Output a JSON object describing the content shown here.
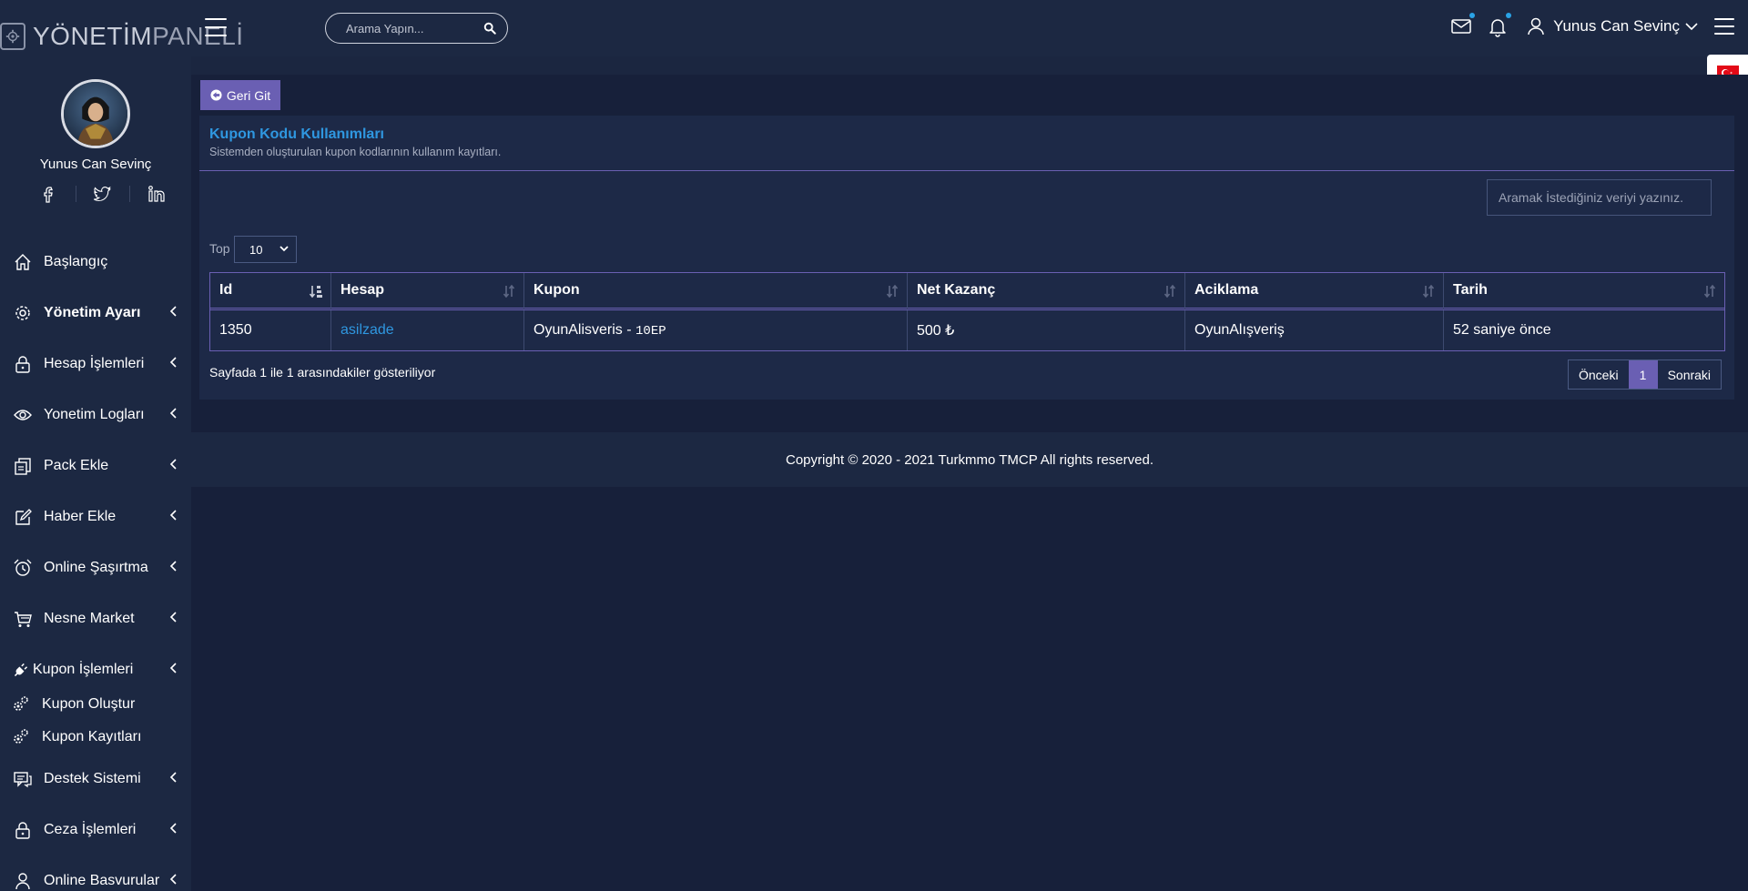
{
  "topbar": {
    "logo_bold": "YÖNETİM",
    "logo_thin": "PANELİ",
    "search_placeholder": "Arama Yapın...",
    "user_name": "Yunus Can Sevinç"
  },
  "sidebar": {
    "user_name": "Yunus Can Sevinç",
    "socials": [
      "facebook-icon",
      "twitter-icon",
      "linkedin-icon"
    ],
    "items": [
      {
        "label": "Başlangıç",
        "icon": "home-icon"
      },
      {
        "label": "Yönetim Ayarı",
        "icon": "gear-icon"
      },
      {
        "label": "Hesap İşlemleri",
        "icon": "lock-icon"
      },
      {
        "label": "Yonetim Logları",
        "icon": "eye-icon"
      },
      {
        "label": "Pack Ekle",
        "icon": "copy-icon"
      },
      {
        "label": "Haber Ekle",
        "icon": "edit-icon"
      },
      {
        "label": "Online Şaşırtma",
        "icon": "alarm-clock-icon"
      },
      {
        "label": "Nesne Market",
        "icon": "cart-icon"
      },
      {
        "label": "Kupon İşlemleri",
        "icon": "plug-icon"
      },
      {
        "label": "Kupon Oluştur",
        "icon": "gears-icon"
      },
      {
        "label": "Kupon Kayıtları",
        "icon": "gears-icon"
      },
      {
        "label": "Destek Sistemi",
        "icon": "chat-icon"
      },
      {
        "label": "Ceza İşlemleri",
        "icon": "lock-icon"
      },
      {
        "label": "Online Basvurular",
        "icon": "person-icon"
      }
    ]
  },
  "main": {
    "back_label": "Geri Git",
    "title": "Kupon Kodu Kullanımları",
    "subtitle": "Sistemden oluşturulan kupon kodlarının kullanım kayıtları.",
    "filter_placeholder": "Aramak İstediğiniz veriyi yazınız.",
    "top_label": "Top",
    "top_value": "10",
    "columns": [
      "Id",
      "Hesap",
      "Kupon",
      "Net Kazanç",
      "Aciklama",
      "Tarih"
    ],
    "rows": [
      {
        "id": "1350",
        "hesap": "asilzade",
        "kupon": "OyunAlisveris - ",
        "kupon_code": "10EP",
        "net": "500 ₺",
        "aciklama": "OyunAlışveriş",
        "tarih": "52 saniye önce"
      }
    ],
    "info": "Sayfada 1 ile 1 arasındakiler gösteriliyor",
    "pager": {
      "prev": "Önceki",
      "current": "1",
      "next": "Sonraki"
    }
  },
  "footer": {
    "text": "Copyright © 2020 - 2021 Turkmmo TMCP All rights reserved."
  },
  "colors": {
    "accent": "#6a5fb3",
    "link": "#2f97e0",
    "bg": "#17203a",
    "panel": "#1c2842"
  }
}
